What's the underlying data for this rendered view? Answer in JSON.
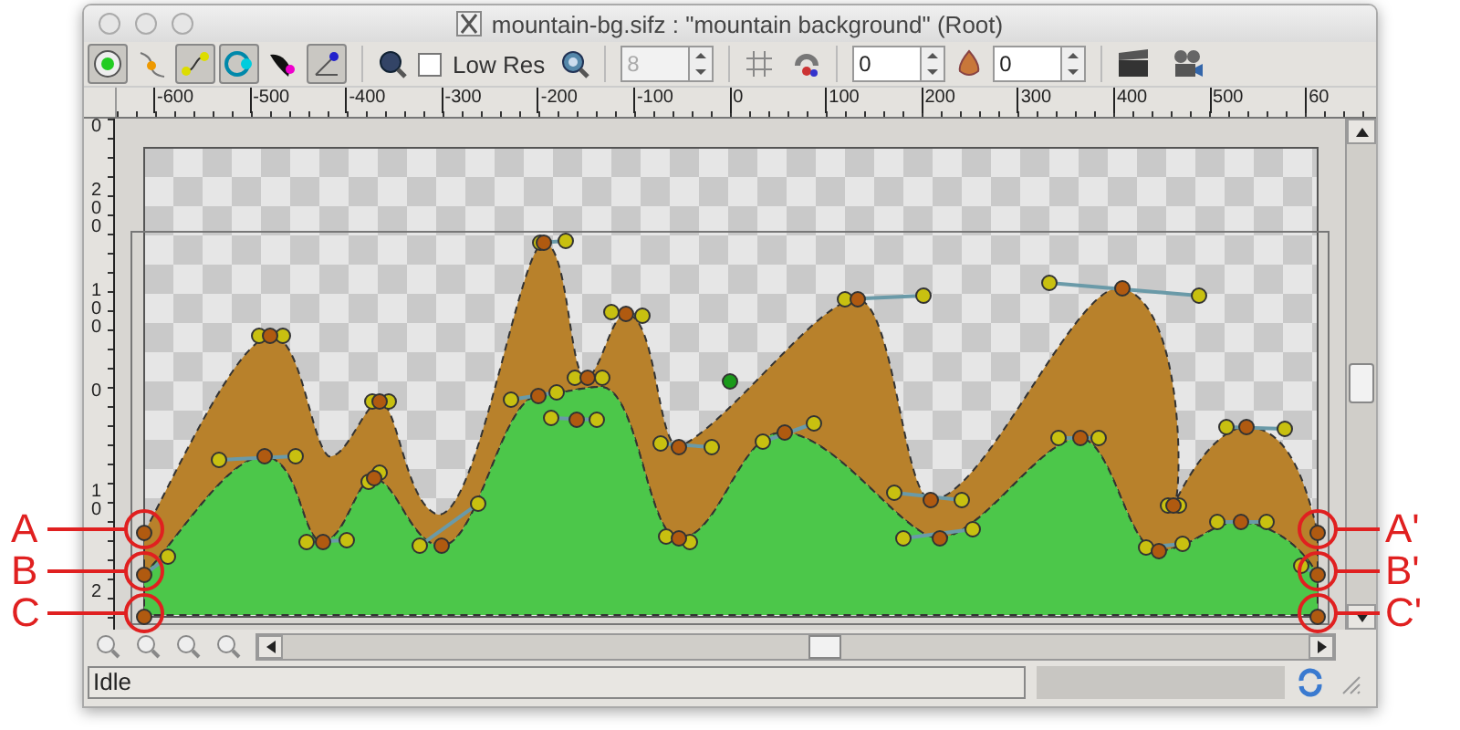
{
  "window": {
    "title": "mountain-bg.sifz : \"mountain background\" (Root)"
  },
  "toolbar": {
    "tools": [
      {
        "kind": "transform",
        "on": true
      },
      {
        "kind": "smooth",
        "on": false
      },
      {
        "kind": "vertex",
        "on": true
      },
      {
        "kind": "circle",
        "on": true
      },
      {
        "kind": "feather",
        "on": false
      },
      {
        "kind": "angle",
        "on": true
      }
    ],
    "low_res": {
      "label": "Low Res",
      "checked": false
    },
    "quality": {
      "value": "8",
      "disabled": true
    },
    "past_onion": {
      "value": "0"
    },
    "future_onion": {
      "value": "0"
    }
  },
  "rulers": {
    "horizontal": [
      "-600",
      "-500",
      "-400",
      "-300",
      "-200",
      "-100",
      "0",
      "100",
      "200",
      "300",
      "400",
      "500",
      "60"
    ],
    "vertical": [
      "0",
      "200",
      "100",
      "0",
      "10",
      "2"
    ]
  },
  "annotations": [
    {
      "label": "A"
    },
    {
      "label": "B"
    },
    {
      "label": "C"
    },
    {
      "label": "A'"
    },
    {
      "label": "B'"
    },
    {
      "label": "C'"
    }
  ],
  "status_bar": {
    "text": "Idle"
  }
}
